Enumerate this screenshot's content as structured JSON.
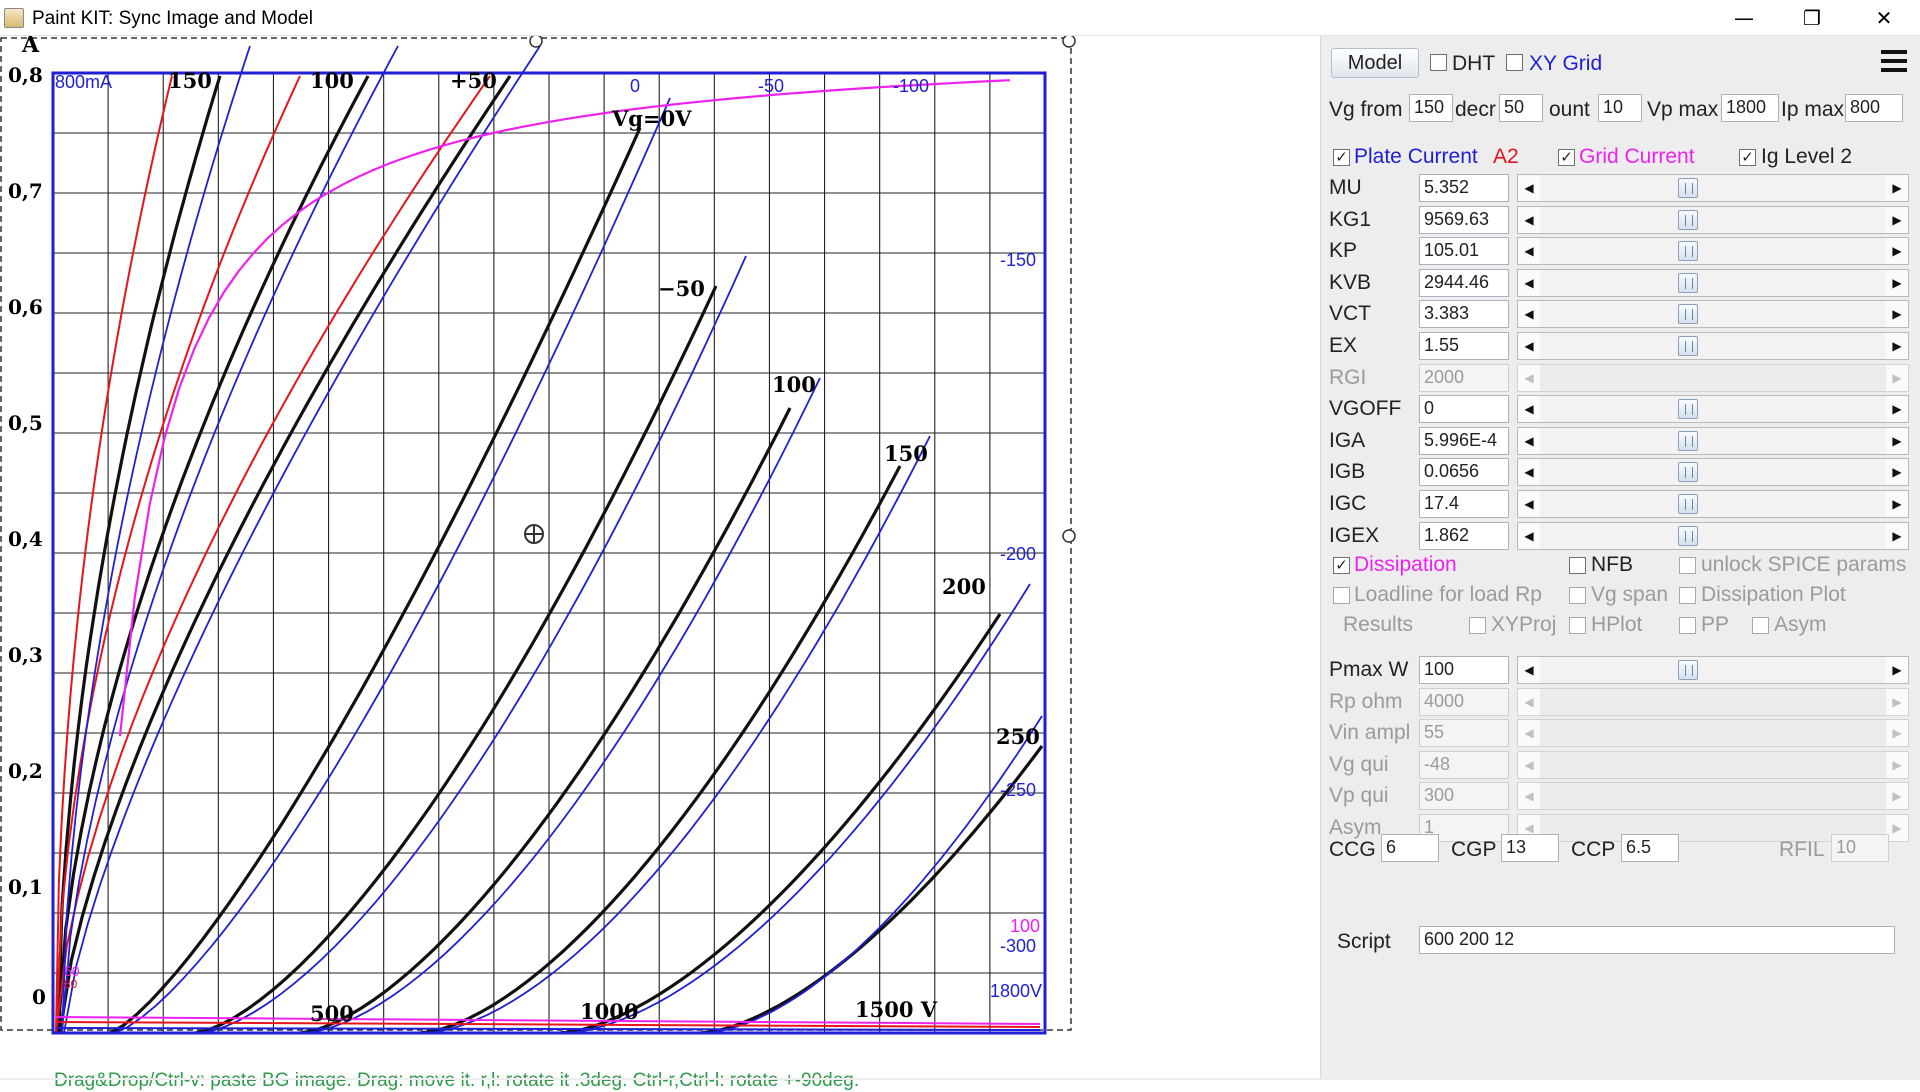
{
  "window": {
    "title": "Paint KIT: Sync Image and Model",
    "minimize_glyph": "—",
    "restore_glyph": "❐",
    "close_glyph": "✕"
  },
  "graph": {
    "y_unit": "A",
    "x_unit_label": "1500 V",
    "y_ticks": [
      "0,8",
      "0,7",
      "0,6",
      "0,5",
      "0,4",
      "0,3",
      "0,2",
      "0,1",
      "0"
    ],
    "x_ticks": [
      "500",
      "1000"
    ],
    "bg_curve_labels": [
      "150",
      "100",
      "+50",
      "Vg=0V",
      "−50",
      "100",
      "150",
      "200",
      "250"
    ],
    "model_labels": [
      "800mA",
      "0",
      "-50",
      "-100",
      "-150",
      "-200",
      "-250",
      "-300",
      "1800V",
      "100",
      "50",
      "80"
    ],
    "hint": "Drag&Drop/Ctrl-v: paste BG image. Drag: move it. r,l: rotate it .3deg. Ctrl-r,Ctrl-l: rotate +-90deg."
  },
  "panel": {
    "model_button": "Model",
    "dht": {
      "label": "DHT",
      "checked": false
    },
    "xy_grid": {
      "label": "XY Grid",
      "checked": false
    },
    "menu_icon": "hamburger-icon",
    "vg_from": {
      "label": "Vg from",
      "value": "150"
    },
    "decr": {
      "label": "decr",
      "value": "50"
    },
    "count": {
      "label": "ount",
      "value": "10"
    },
    "vp_max": {
      "label": "Vp max",
      "value": "1800"
    },
    "ip_max": {
      "label": "Ip max",
      "value": "800"
    },
    "plate_current": {
      "label": "Plate Current",
      "checked": true
    },
    "a2_label": "A2",
    "grid_current": {
      "label": "Grid Current",
      "checked": true
    },
    "ig_level2": {
      "label": "Ig Level 2",
      "checked": true
    },
    "params": [
      {
        "label": "MU",
        "value": "5.352",
        "enabled": true
      },
      {
        "label": "KG1",
        "value": "9569.63",
        "enabled": true
      },
      {
        "label": "KP",
        "value": "105.01",
        "enabled": true
      },
      {
        "label": "KVB",
        "value": "2944.46",
        "enabled": true
      },
      {
        "label": "VCT",
        "value": "3.383",
        "enabled": true
      },
      {
        "label": "EX",
        "value": "1.55",
        "enabled": true
      },
      {
        "label": "RGI",
        "value": "2000",
        "enabled": false
      },
      {
        "label": "VGOFF",
        "value": "0",
        "enabled": true
      },
      {
        "label": "IGA",
        "value": "5.996E-4",
        "enabled": true
      },
      {
        "label": "IGB",
        "value": "0.0656",
        "enabled": true
      },
      {
        "label": "IGC",
        "value": "17.4",
        "enabled": true
      },
      {
        "label": "IGEX",
        "value": "1.862",
        "enabled": true
      }
    ],
    "dissipation": {
      "label": "Dissipation",
      "checked": true
    },
    "nfb": {
      "label": "NFB",
      "checked": false
    },
    "unlock_spice": {
      "label": "unlock SPICE params",
      "checked": false
    },
    "loadline": {
      "label": "Loadline for load Rp",
      "checked": false
    },
    "vg_span": {
      "label": "Vg span",
      "checked": false
    },
    "dissipation_plot": {
      "label": "Dissipation Plot",
      "checked": false
    },
    "results_label": "Results",
    "xyproj": {
      "label": "XYProj",
      "checked": false
    },
    "hplot": {
      "label": "HPlot",
      "checked": false
    },
    "pp": {
      "label": "PP",
      "checked": false
    },
    "asym_cb": {
      "label": "Asym",
      "checked": false
    },
    "loadparams": [
      {
        "label": "Pmax W",
        "value": "100",
        "enabled": true
      },
      {
        "label": "Rp ohm",
        "value": "4000",
        "enabled": false
      },
      {
        "label": "Vin ampl",
        "value": "55",
        "enabled": false
      },
      {
        "label": "Vg qui",
        "value": "-48",
        "enabled": false
      },
      {
        "label": "Vp qui",
        "value": "300",
        "enabled": false
      },
      {
        "label": "Asym",
        "value": "1",
        "enabled": false
      }
    ],
    "ccg": {
      "label": "CCG",
      "value": "6"
    },
    "cgp": {
      "label": "CGP",
      "value": "13"
    },
    "ccp": {
      "label": "CCP",
      "value": "6.5"
    },
    "rfil": {
      "label": "RFIL",
      "value": "10"
    },
    "script": {
      "label": "Script",
      "value": "600 200 12"
    }
  },
  "colors": {
    "model_blue": "#1f1fd6",
    "grid_red": "#e8141c",
    "dissipation_magenta": "#ee22ee",
    "hint_green": "#2e9a4a"
  }
}
